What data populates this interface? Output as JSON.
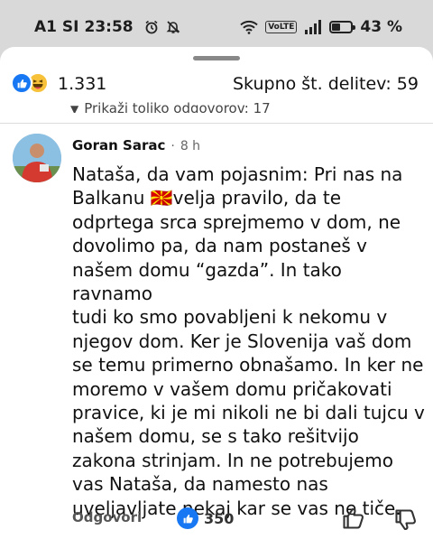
{
  "status": {
    "carrier": "A1 SI",
    "time": "23:58",
    "volte": "VoLTE",
    "battery_percent": 43,
    "battery_label": "43 %"
  },
  "summary": {
    "reaction_count": "1.331",
    "shares_label": "Skupno št. delitev: 59"
  },
  "thread": {
    "show_replies_label": "Prikaži toliko odgovorov: 17"
  },
  "comment": {
    "author": "Goran Sarac",
    "separator": "·",
    "time_ago": "8 h",
    "flag": "🇲🇰",
    "text_before_flag": "Nataša, da vam pojasnim: Pri nas na\nBalkanu ",
    "text_after_flag": "velja pravilo, da te\nodprtega srca sprejmemo v dom, ne\ndovolimo pa, da nam postaneš v\nnašem domu “gazda”. In tako ravnamo\ntudi ko smo povabljeni k nekomu v\nnjegov dom. Ker je Slovenija vaš dom\nse temu primerno obnašamo. In ker ne\nmoremo v vašem domu pričakovati\npravice, ki je mi nikoli ne bi dali tujcu v\nnašem domu, se s tako rešitvijo\nzakona strinjam. In ne potrebujemo\nvas Nataša, da namesto nas\nuveljavljate nekaj kar se vas ne tiče.",
    "reply_label": "Odgovori",
    "like_count": "350"
  },
  "icons": {
    "alarm": "alarm-icon",
    "mute": "notifications-off-icon",
    "wifi": "wifi-icon",
    "signal": "signal-icon",
    "battery": "battery-icon",
    "like": "like-icon",
    "haha": "haha-icon",
    "thumb_up": "thumb-up-icon",
    "thumb_down": "thumb-down-icon"
  },
  "colors": {
    "facebook_blue": "#1877f2",
    "haha_yellow": "#f7c23a"
  }
}
